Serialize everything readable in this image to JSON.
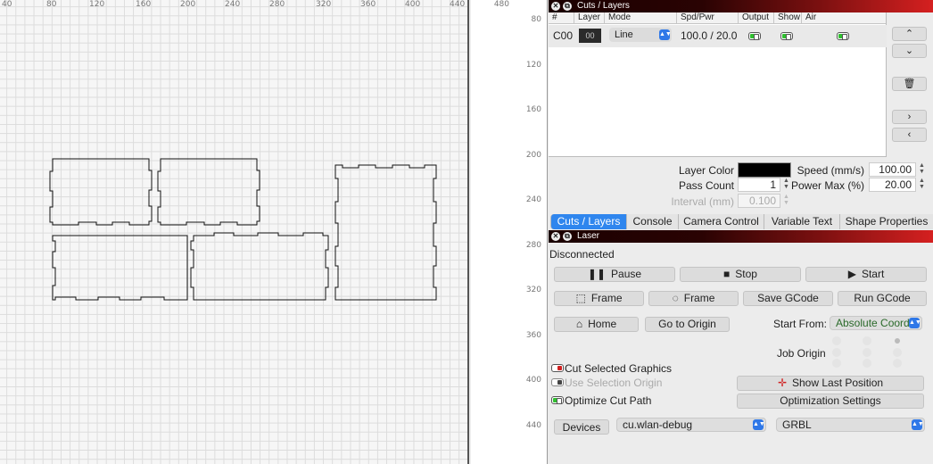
{
  "ruler": {
    "top": [
      "40",
      "80",
      "120",
      "160",
      "200",
      "240",
      "280",
      "320",
      "360",
      "400",
      "440",
      "480"
    ],
    "left": [
      "80",
      "120",
      "160",
      "200",
      "240",
      "280",
      "320",
      "360",
      "400",
      "440"
    ]
  },
  "cuts_panel": {
    "title": "Cuts / Layers",
    "columns": [
      "#",
      "Layer",
      "Mode",
      "Spd/Pwr",
      "Output",
      "Show",
      "Air"
    ],
    "rows": [
      {
        "id": "C00",
        "layer": "00",
        "mode": "Line",
        "spd_pwr": "100.0 / 20.0",
        "output": true,
        "show": true,
        "air": true
      }
    ],
    "layer_color_label": "Layer Color",
    "layer_color": "#000000",
    "speed_label": "Speed (mm/s)",
    "speed_value": "100.00",
    "pass_count_label": "Pass Count",
    "pass_count_value": "1",
    "power_max_label": "Power Max (%)",
    "power_max_value": "20.00",
    "interval_label": "Interval (mm)",
    "interval_value": "0.100"
  },
  "tabs": [
    "Cuts / Layers",
    "Console",
    "Camera Control",
    "Variable Text",
    "Shape Properties"
  ],
  "laser_panel": {
    "title": "Laser",
    "status": "Disconnected",
    "pause_label": "Pause",
    "stop_label": "Stop",
    "start_label": "Start",
    "frame_label": "Frame",
    "frame_round_label": "Frame",
    "save_gcode_label": "Save GCode",
    "run_gcode_label": "Run GCode",
    "home_label": "Home",
    "go_origin_label": "Go to Origin",
    "start_from_label": "Start From:",
    "start_from_value": "Absolute Coords",
    "job_origin_label": "Job Origin",
    "cut_selected_label": "Cut Selected Graphics",
    "use_selection_origin_label": "Use Selection Origin",
    "optimize_cut_path_label": "Optimize Cut Path",
    "show_last_position_label": "Show Last Position",
    "optimization_settings_label": "Optimization Settings",
    "devices_label": "Devices",
    "port_value": "cu.wlan-debug",
    "controller_value": "GRBL"
  },
  "colors": {
    "accent": "#2f86ee",
    "title_red": "#d52020",
    "toggle_on": "#2fbf2f"
  }
}
